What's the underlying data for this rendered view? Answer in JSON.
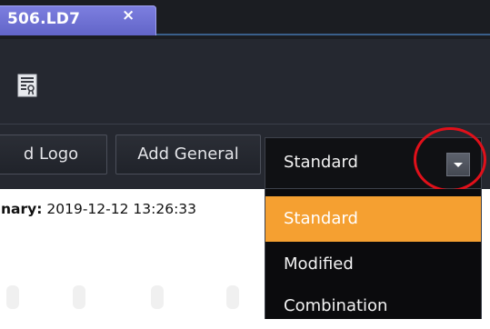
{
  "tab": {
    "label": "506.LD7",
    "close_glyph": "×"
  },
  "ribbon": {
    "icon": "report-document-icon",
    "buttons": {
      "logo_label": "d Logo",
      "general_label": "Add General"
    }
  },
  "combo": {
    "value": "Standard",
    "arrow_icon": "chevron-down-icon"
  },
  "summary": {
    "label": "nary:",
    "value": "2019-12-12 13:26:33"
  },
  "dropdown": {
    "options": [
      "Standard",
      "Modified",
      "Combination"
    ],
    "selected": "Standard"
  },
  "colors": {
    "tab_accent": "#6265c8",
    "selected_option": "#f5a031",
    "annotation_circle": "#e0101a"
  }
}
